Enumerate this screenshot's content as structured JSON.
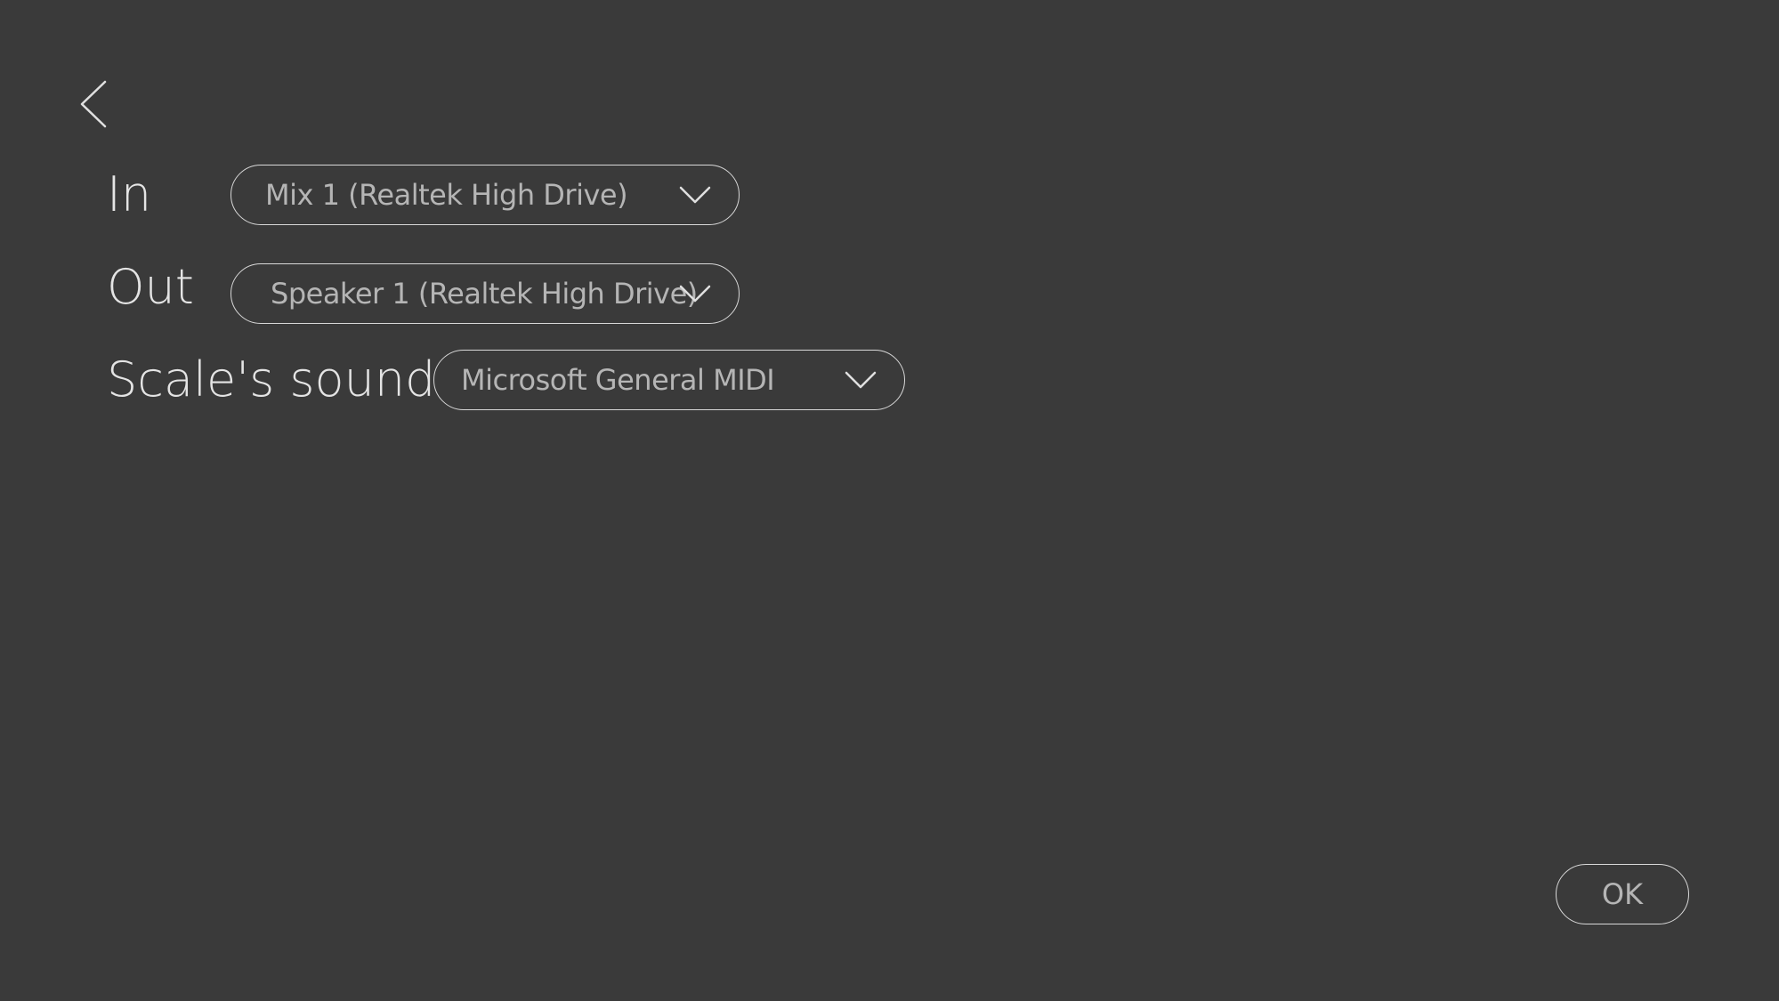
{
  "back": {
    "icon": "chevron-left-icon"
  },
  "settings": {
    "input": {
      "label": "In",
      "value": "Mix 1 (Realtek High Drive)",
      "icon": "chevron-down-icon"
    },
    "output": {
      "label": "Out",
      "value": "Speaker 1 (Realtek High Drive)",
      "icon": "chevron-down-icon"
    },
    "scale_sound": {
      "label": "Scale's sound",
      "value": "Microsoft General MIDI",
      "icon": "chevron-down-icon"
    }
  },
  "footer": {
    "ok_label": "OK"
  },
  "colors": {
    "background": "#3a3a3a",
    "outline": "#d8d8d8",
    "label_text": "#e4e4e4",
    "value_text": "#b5b5b5"
  }
}
